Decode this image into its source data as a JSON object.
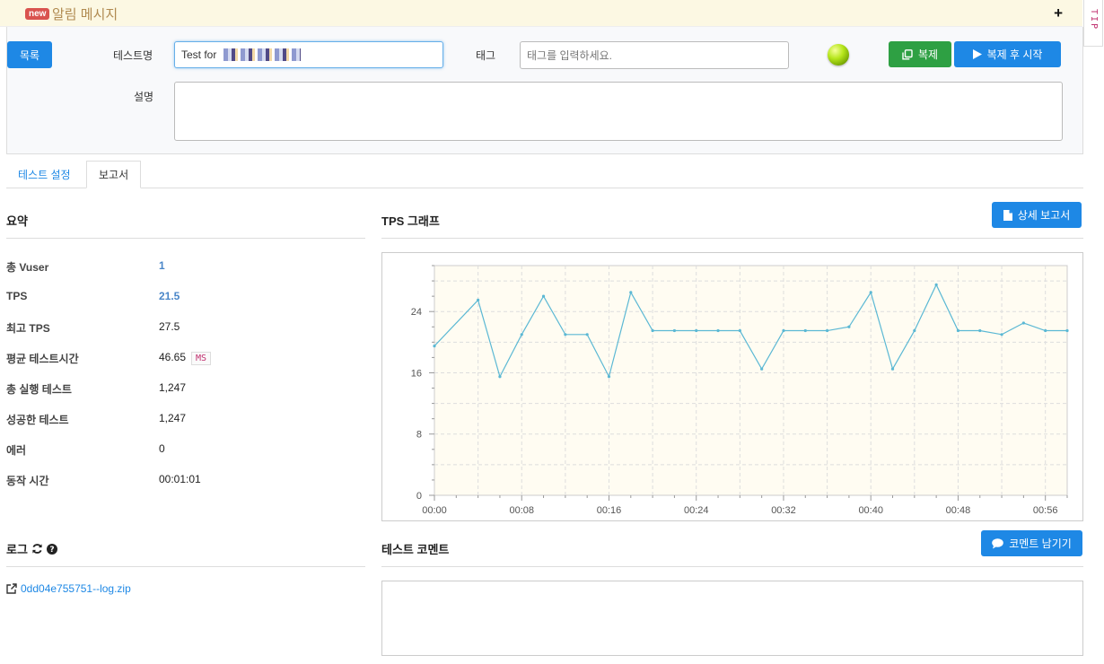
{
  "notice": {
    "badge": "new",
    "title": "알림 메시지",
    "toggle": "+"
  },
  "tip": "TIP",
  "form": {
    "list_button": "목록",
    "test_name_label": "테스트명",
    "test_name_value": "Test for",
    "tag_label": "태그",
    "tag_placeholder": "태그를 입력하세요.",
    "description_label": "설명",
    "clone_button": "복제",
    "clone_start_button": "복제 후 시작"
  },
  "tabs": [
    {
      "label": "테스트 설정"
    },
    {
      "label": "보고서"
    }
  ],
  "summary": {
    "title": "요약",
    "rows": [
      {
        "key": "총 Vuser",
        "value": "1"
      },
      {
        "key": "TPS",
        "value": "21.5"
      },
      {
        "key": "최고 TPS",
        "value": "27.5"
      },
      {
        "key": "평균 테스트시간",
        "value": "46.65",
        "unit": "MS"
      },
      {
        "key": "총 실행 테스트",
        "value": "1,247"
      },
      {
        "key": "성공한 테스트",
        "value": "1,247"
      },
      {
        "key": "에러",
        "value": "0"
      },
      {
        "key": "동작 시간",
        "value": "00:01:01"
      }
    ]
  },
  "tps": {
    "title": "TPS 그래프",
    "detail_button": "상세 보고서"
  },
  "log": {
    "title": "로그",
    "file": "0dd04e755751--log.zip"
  },
  "comment": {
    "title": "테스트 코멘트",
    "button": "코멘트 남기기"
  },
  "colors": {
    "primary": "#1e88e5",
    "success": "#2ea043",
    "line": "#5bb8d4",
    "plot_bg": "#fffcf2"
  },
  "chart_data": {
    "type": "line",
    "xlabel": "",
    "ylabel": "",
    "xlim": [
      0,
      58
    ],
    "ylim": [
      0,
      30
    ],
    "x_tick_labels": [
      "00:00",
      "00:08",
      "00:16",
      "00:24",
      "00:32",
      "00:40",
      "00:48",
      "00:56"
    ],
    "x_tick_values": [
      0,
      8,
      16,
      24,
      32,
      40,
      48,
      56
    ],
    "y_tick_labels": [
      "0",
      "8",
      "16",
      "24"
    ],
    "y_tick_values": [
      0,
      8,
      16,
      24
    ],
    "series": [
      {
        "x": [
          0,
          4,
          6,
          8,
          10,
          12,
          14,
          16,
          18,
          20,
          22,
          24,
          26,
          28,
          30,
          32,
          34,
          36,
          38,
          40,
          42,
          44,
          46,
          48,
          50,
          52,
          54,
          56,
          58
        ],
        "values": [
          19.5,
          25.5,
          15.5,
          21,
          26,
          21,
          21,
          15.5,
          26.5,
          21.5,
          21.5,
          21.5,
          21.5,
          21.5,
          16.5,
          21.5,
          21.5,
          21.5,
          22,
          26.5,
          16.5,
          21.5,
          27.5,
          21.5,
          21.5,
          21,
          22.5,
          21.5,
          21.5
        ]
      }
    ]
  }
}
